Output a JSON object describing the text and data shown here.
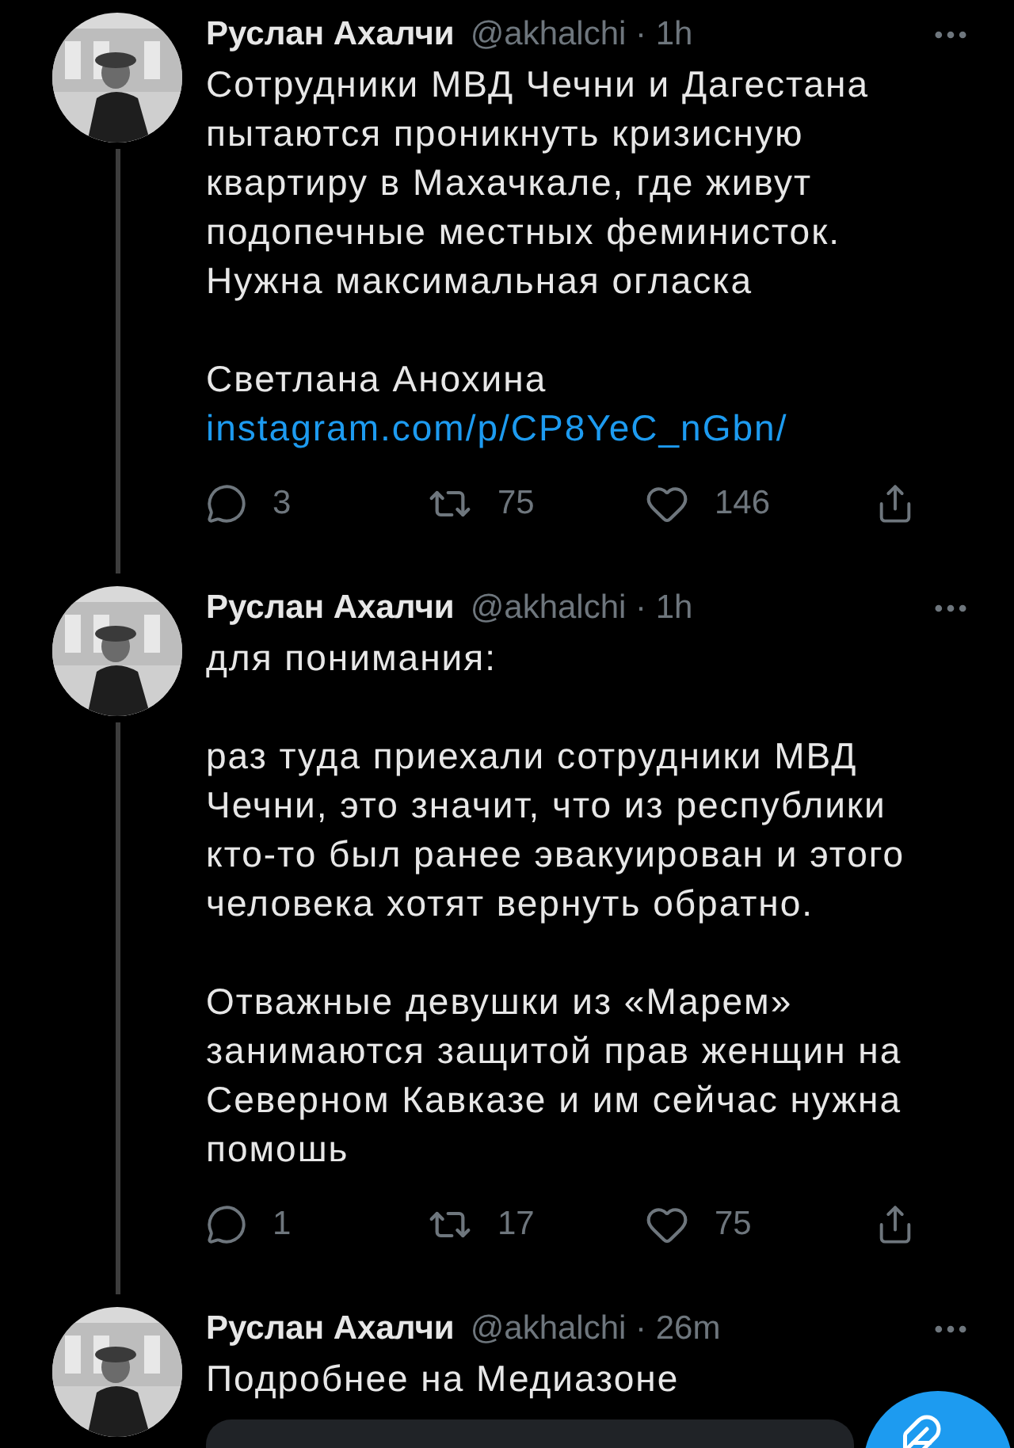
{
  "tweets": [
    {
      "name": "Руслан Ахалчи",
      "meta": "@akhalchi · 1h",
      "thread_below": true,
      "paragraphs": [
        [
          {
            "kind": "text",
            "text": "Сотрудники МВД Чечни и Дагестана пытаются проникнуть кризисную квартиру в Махачкале, где живут подопечные местных феминисток. Нужна максимальная огласка"
          }
        ],
        [
          {
            "kind": "text",
            "text": "Светлана Анохина"
          },
          {
            "kind": "link",
            "text": "instagram.com/p/CP8YeC_nGbn/"
          }
        ]
      ],
      "replies": "3",
      "retweets": "75",
      "likes": "146"
    },
    {
      "name": "Руслан Ахалчи",
      "meta": "@akhalchi · 1h",
      "thread_below": true,
      "paragraphs": [
        [
          {
            "kind": "text",
            "text": "для понимания:"
          }
        ],
        [
          {
            "kind": "text",
            "text": "раз туда приехали сотрудники МВД Чечни, это значит, что из республики кто-то был ранее эвакуирован и этого человека хотят вернуть обратно."
          }
        ],
        [
          {
            "kind": "text",
            "text": "Отважные девушки из «Марем» занимаются защитой прав женщин на Северном Кавказе и им сейчас нужна помошь"
          }
        ]
      ],
      "replies": "1",
      "retweets": "17",
      "likes": "75"
    },
    {
      "name": "Руслан Ахалчи",
      "meta": "@akhalchi · 26m",
      "thread_below": false,
      "paragraphs": [
        [
          {
            "kind": "text",
            "text": "Подробнее на Медиазоне"
          }
        ]
      ],
      "link_card": true
    }
  ],
  "compose_button": true
}
